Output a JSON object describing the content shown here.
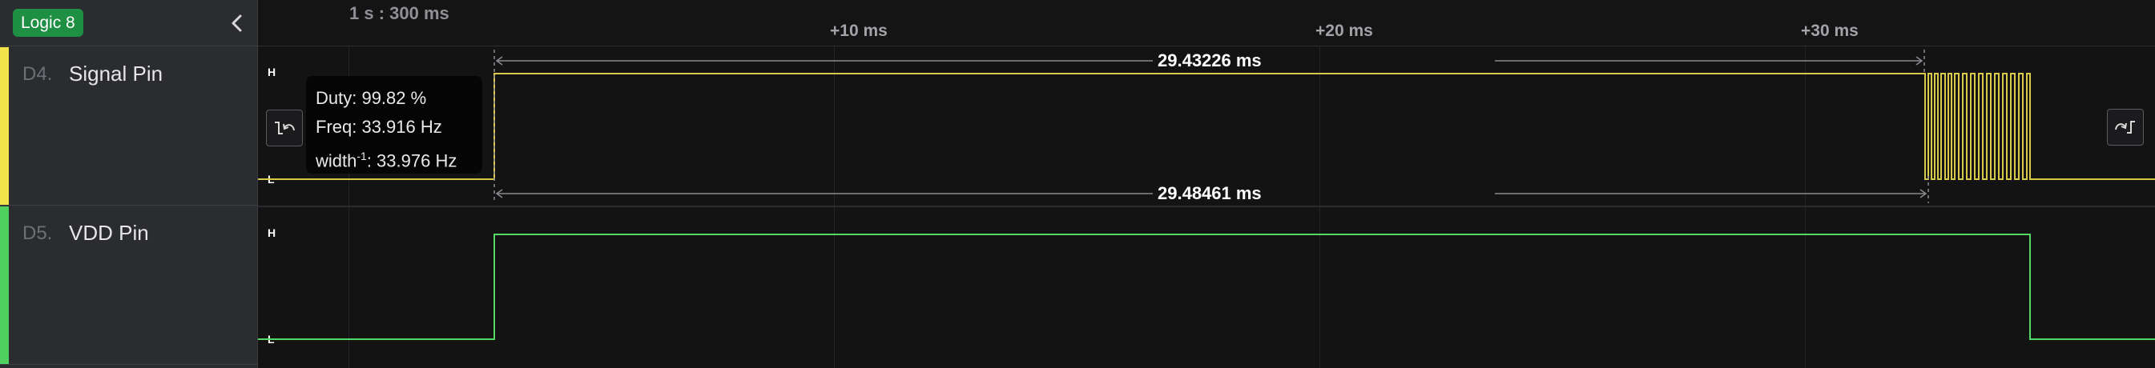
{
  "device": {
    "name": "Logic 8"
  },
  "channels": [
    {
      "index": "D4.",
      "name": "Signal Pin",
      "color": "#f2e34a"
    },
    {
      "index": "D5.",
      "name": "VDD Pin",
      "color": "#4fd15f"
    }
  ],
  "ruler": {
    "origin_label": "1 s : 300 ms",
    "ticks": [
      "+10 ms",
      "+20 ms",
      "+30 ms"
    ]
  },
  "levels": {
    "high": "H",
    "low": "L"
  },
  "measurement": {
    "duty": "Duty: 99.82 %",
    "freq": "Freq: 33.916 Hz",
    "width_prefix": "width",
    "width_sup": "-1",
    "width_suffix": ": 33.976 Hz"
  },
  "dimensions": {
    "upper": "29.43226 ms",
    "lower": "29.48461 ms"
  },
  "icons": {
    "collapse": "chevron-left-icon",
    "prev_edge": "previous-edge-icon",
    "next_edge": "next-edge-icon"
  },
  "colors": {
    "device_badge": "#1e8f43",
    "signal_trace": "#d9c94a",
    "vdd_trace": "#54d964",
    "background": "#131313",
    "panel": "#2b2c30"
  }
}
